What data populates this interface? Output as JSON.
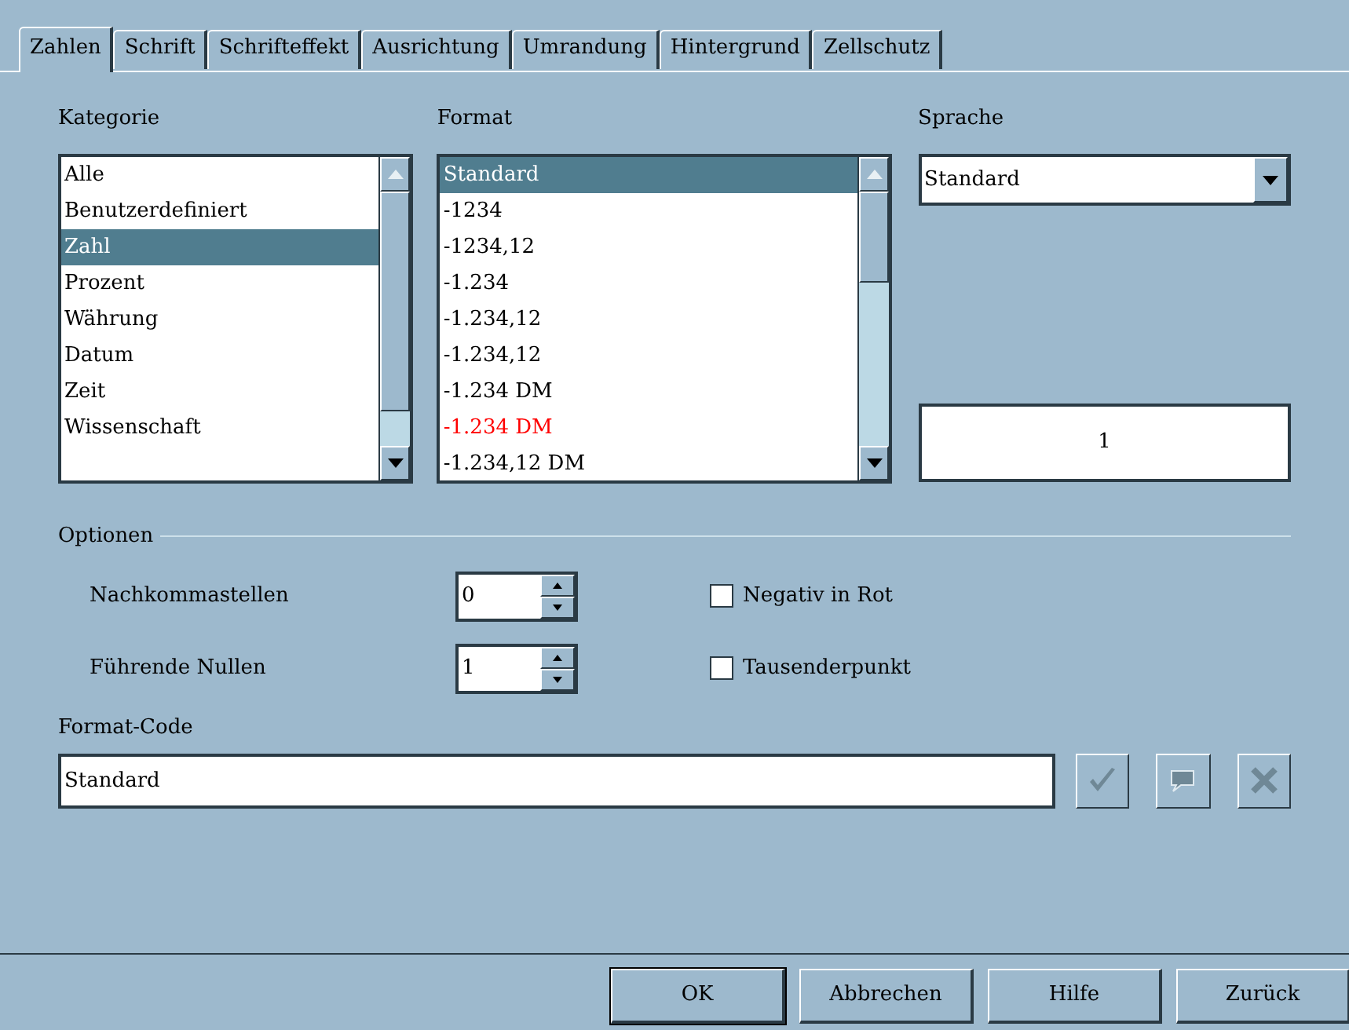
{
  "tabs": [
    {
      "label": "Zahlen",
      "selected": true
    },
    {
      "label": "Schrift",
      "selected": false
    },
    {
      "label": "Schrifteffekt",
      "selected": false
    },
    {
      "label": "Ausrichtung",
      "selected": false
    },
    {
      "label": "Umrandung",
      "selected": false
    },
    {
      "label": "Hintergrund",
      "selected": false
    },
    {
      "label": "Zellschutz",
      "selected": false
    }
  ],
  "kategorie": {
    "label": "Kategorie",
    "items": [
      {
        "text": "Alle",
        "selected": false
      },
      {
        "text": "Benutzerdefiniert",
        "selected": false
      },
      {
        "text": "Zahl",
        "selected": true
      },
      {
        "text": "Prozent",
        "selected": false
      },
      {
        "text": "Währung",
        "selected": false
      },
      {
        "text": "Datum",
        "selected": false
      },
      {
        "text": "Zeit",
        "selected": false
      },
      {
        "text": "Wissenschaft",
        "selected": false
      }
    ]
  },
  "format": {
    "label": "Format",
    "items": [
      {
        "text": "Standard",
        "selected": true,
        "negative": false
      },
      {
        "text": "-1234",
        "selected": false,
        "negative": false
      },
      {
        "text": "-1234,12",
        "selected": false,
        "negative": false
      },
      {
        "text": "-1.234",
        "selected": false,
        "negative": false
      },
      {
        "text": "-1.234,12",
        "selected": false,
        "negative": false
      },
      {
        "text": "-1.234,12",
        "selected": false,
        "negative": false
      },
      {
        "text": "-1.234 DM",
        "selected": false,
        "negative": false
      },
      {
        "text": "-1.234 DM",
        "selected": false,
        "negative": true
      },
      {
        "text": "-1.234,12 DM",
        "selected": false,
        "negative": false
      }
    ]
  },
  "sprache": {
    "label": "Sprache",
    "value": "Standard"
  },
  "preview": "1",
  "optionen": {
    "title": "Optionen",
    "spinners": [
      {
        "label": "Nachkommastellen",
        "value": "0"
      },
      {
        "label": "Führende Nullen",
        "value": "1"
      }
    ],
    "checkboxes": [
      {
        "label": "Negativ in Rot",
        "checked": false
      },
      {
        "label": "Tausenderpunkt",
        "checked": false
      }
    ]
  },
  "format_code": {
    "label": "Format-Code",
    "value": "Standard"
  },
  "buttons": [
    "OK",
    "Abbrechen",
    "Hilfe",
    "Zurück"
  ]
}
